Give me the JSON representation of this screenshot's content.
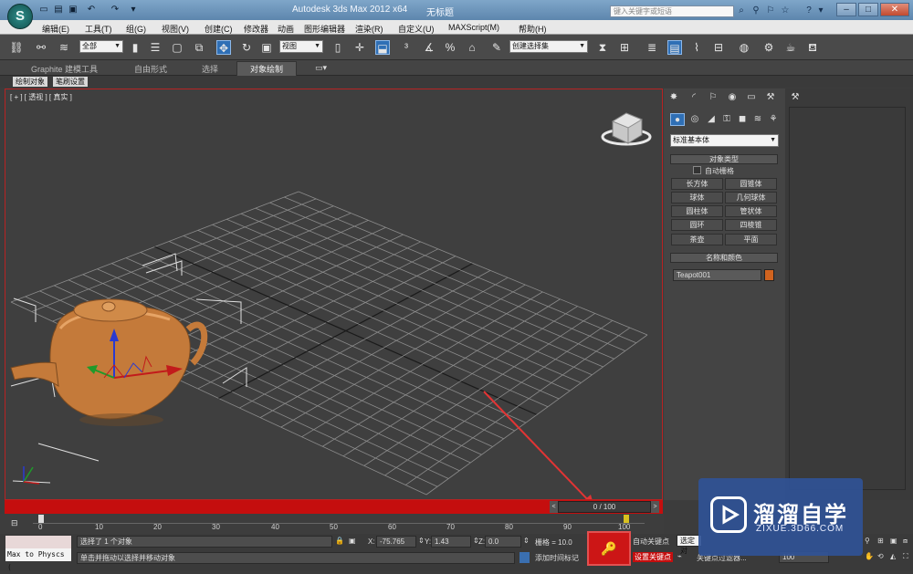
{
  "window": {
    "app_title": "Autodesk 3ds Max  2012 x64",
    "doc_title": "无标题",
    "logo_glyph": "S"
  },
  "search": {
    "placeholder": "键入关键字或短语"
  },
  "menu": [
    "编辑(E)",
    "工具(T)",
    "组(G)",
    "视图(V)",
    "创建(C)",
    "修改器",
    "动画",
    "图形编辑器",
    "渲染(R)",
    "自定义(U)",
    "MAXScript(M)",
    "帮助(H)"
  ],
  "toolbar": {
    "selection_filter": "全部",
    "ref_coord": "视图",
    "named_sel": "创建选择集"
  },
  "ribbon": {
    "tabs": [
      "Graphite 建模工具",
      "自由形式",
      "选择",
      "对象绘制"
    ],
    "active_tab_index": 3,
    "sub_tabs": [
      "绘制对象",
      "笔刷设置"
    ]
  },
  "viewport": {
    "label": "[ + ] [ 透视 ] [ 真实 ]"
  },
  "command_panel": {
    "category_dropdown": "标准基本体",
    "object_type_header": "对象类型",
    "autogrid_label": "自动栅格",
    "object_buttons": [
      "长方体",
      "圆锥体",
      "球体",
      "几何球体",
      "圆柱体",
      "管状体",
      "圆环",
      "四棱锥",
      "茶壶",
      "平面"
    ],
    "name_color_header": "名称和颜色",
    "object_name": "Teapot001",
    "object_color": "#d0631f"
  },
  "timeline": {
    "frame_display": "0 / 100",
    "ticks": [
      "0",
      "10",
      "20",
      "30",
      "40",
      "50",
      "60",
      "70",
      "80",
      "90",
      "100"
    ]
  },
  "status": {
    "maxscript_listener": "Max to Physcs (",
    "selected_text": "选择了 1 个对象",
    "prompt_text": "单击并拖动以选择并移动对象",
    "x_label": "X:",
    "x_value": "-75.765",
    "y_label": "Y:",
    "y_value": "1.43",
    "z_label": "Z:",
    "z_value": "0.0",
    "grid_text": "栅格 = 10.0",
    "add_time_tag": "添加时间标记",
    "auto_key": "自动关键点",
    "set_key": "设置关键点",
    "key_filter_text": "关键点过滤器...",
    "selected_dropdown": "选定对",
    "frame_dropdown": "100"
  },
  "watermark": {
    "title": "溜溜自学",
    "subtitle": "ZIXUE.3D66.COM"
  },
  "colors": {
    "accent_red": "#c50e0e",
    "teapot": "#c47a3a",
    "ribbon_active": "#555555"
  }
}
